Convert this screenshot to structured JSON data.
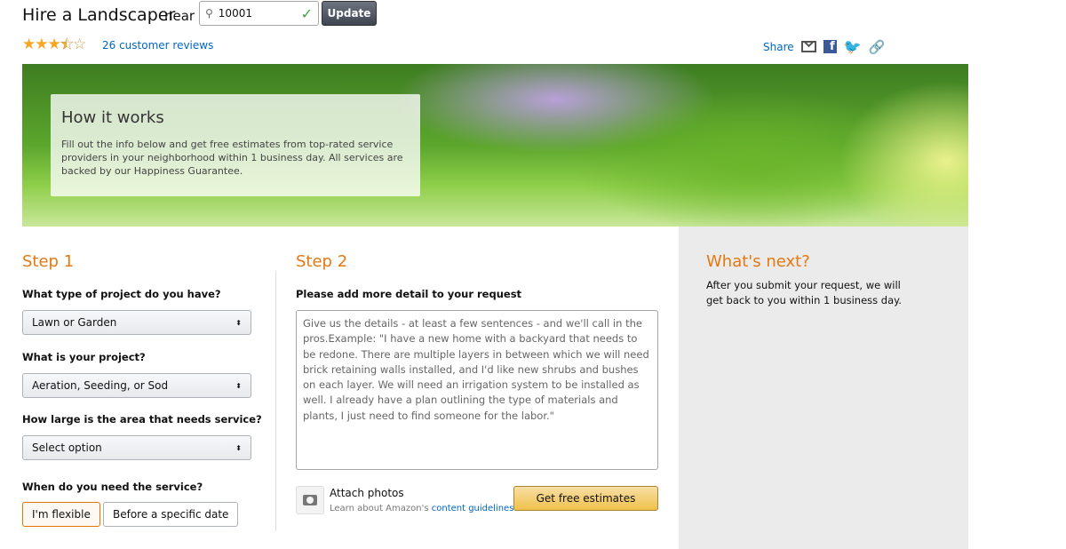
{
  "header": {
    "title": "Hire a Landscaper",
    "near": "near",
    "zip": "10001",
    "update": "Update",
    "rating": 3.5,
    "reviews": "26 customer reviews",
    "share": "Share"
  },
  "banner": {
    "title": "How it works",
    "text": "Fill out the info below and get free estimates from top-rated service providers in your neighborhood within 1 business day. All services are backed by our Happiness Guarantee."
  },
  "step1": {
    "title": "Step 1",
    "q1": "What type of project do you have?",
    "a1": "Lawn or Garden",
    "q2": "What is your project?",
    "a2": "Aeration, Seeding, or Sod",
    "q3": "How large is the area that needs service?",
    "a3": "Select option",
    "q4": "When do you need the service?",
    "opt1": "I'm flexible",
    "opt2": "Before a specific date"
  },
  "step2": {
    "title": "Step 2",
    "label": "Please add more detail to your request",
    "placeholder": "Give us the details - at least a few sentences - and we'll call in the pros.Example: \"I have a new home with a backyard that needs to be redone. There are multiple layers in between which we will need brick retaining walls installed, and I'd like new shrubs and bushes on each layer. We will need an irrigation system to be installed as well. I already have a plan outlining the type of materials and plants, I just need to find someone for the labor.\"",
    "attach": "Attach photos",
    "learn": "Learn about Amazon's",
    "guidelines": "content guidelines",
    "submit": "Get free estimates"
  },
  "next": {
    "title": "What's next?",
    "text": "After you submit your request, we will get back to you within 1 business day."
  },
  "colors": {
    "accent": "#e47911",
    "link": "#0066c0",
    "panel": "#ebebeb"
  }
}
